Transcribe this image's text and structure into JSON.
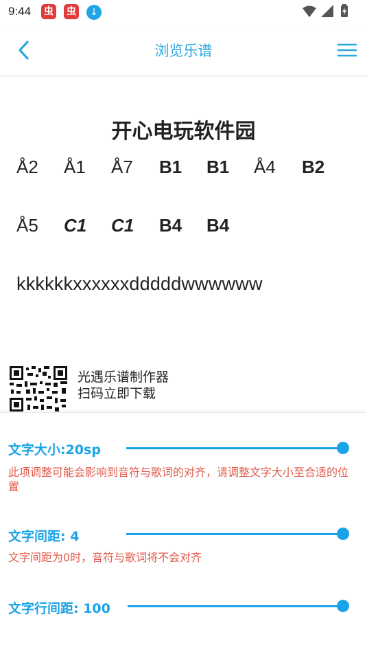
{
  "status_bar": {
    "time": "9:44",
    "notif_glyph": "虫",
    "download_icon": "download-icon",
    "system_icons": [
      "wifi-icon",
      "signal-icon",
      "battery-icon"
    ]
  },
  "app_bar": {
    "title": "浏览乐谱",
    "back_icon": "chevron-left-icon",
    "menu_icon": "hamburger-menu-icon",
    "accent_color": "#29a8e0"
  },
  "sheet": {
    "title": "开心电玩软件园",
    "row1": [
      "Å2",
      "Å1",
      "Å7",
      "B1",
      "B1",
      "Å4",
      "B2"
    ],
    "row2": [
      "Å5",
      "C1",
      "C1",
      "B4",
      "B4"
    ],
    "lyric": "kkkkkkxxxxxxdddddwwwwww"
  },
  "promo": {
    "line1": "光遇乐谱制作器",
    "line2": "扫码立即下载"
  },
  "settings": {
    "font_size": {
      "label": "文字大小:20sp",
      "level": 1.0,
      "note": "此项调整可能会影响到音符与歌词的对齐，请调整文字大小至合适的位置"
    },
    "char_spacing": {
      "label": "文字间距: 4",
      "level": 1.0,
      "note": "文字间距为0时，音符与歌词将不会对齐"
    },
    "line_spacing": {
      "label": "文字行间距: 100",
      "level": 1.0
    },
    "accent_color": "#1aa3e8",
    "warning_color": "#e05a4a"
  }
}
